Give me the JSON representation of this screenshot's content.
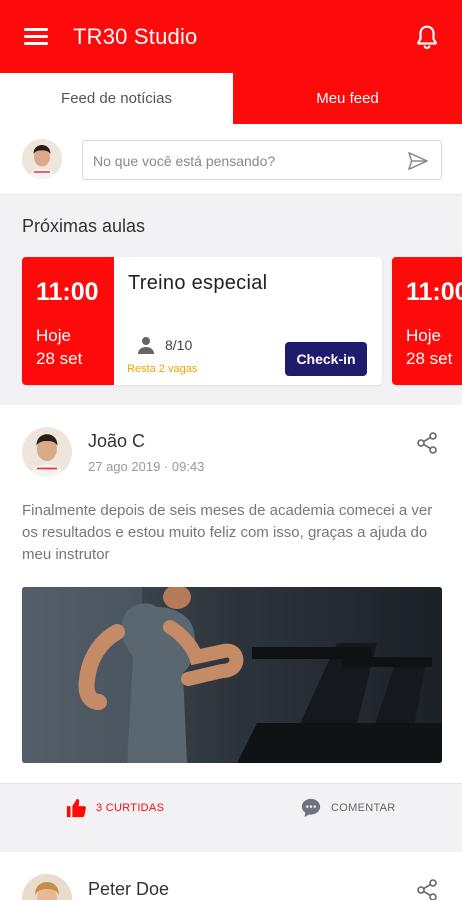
{
  "app": {
    "title": "TR30 Studio",
    "menu_icon": "hamburger-icon",
    "notification_icon": "bell-icon",
    "brand_color": "#ff0a0a"
  },
  "tabs": [
    {
      "label": "Feed de notícias",
      "selected": false
    },
    {
      "label": "Meu feed",
      "selected": true
    }
  ],
  "composer": {
    "placeholder": "No que você está pensando?",
    "send_icon": "send-icon"
  },
  "upcoming": {
    "heading": "Próximas aulas",
    "classes": [
      {
        "time": "11:00",
        "day": "Hoje",
        "date": "28 set",
        "name": "Treino especial",
        "occupancy": "8/10",
        "spots_left": "Resta 2 vagas",
        "checkin_label": "Check-in"
      },
      {
        "time": "11:00",
        "day": "Hoje",
        "date": "28 set"
      }
    ]
  },
  "posts": [
    {
      "author": "João C",
      "date": "27 ago 2019 · 09:43",
      "text": "Finalmente depois de seis meses de academia comecei a ver os resultados e estou muito feliz com isso, graças a ajuda do meu instrutor",
      "likes_label": "3 CURTIDAS",
      "comment_label": "COMENTAR"
    },
    {
      "author": "Peter Doe"
    }
  ]
}
